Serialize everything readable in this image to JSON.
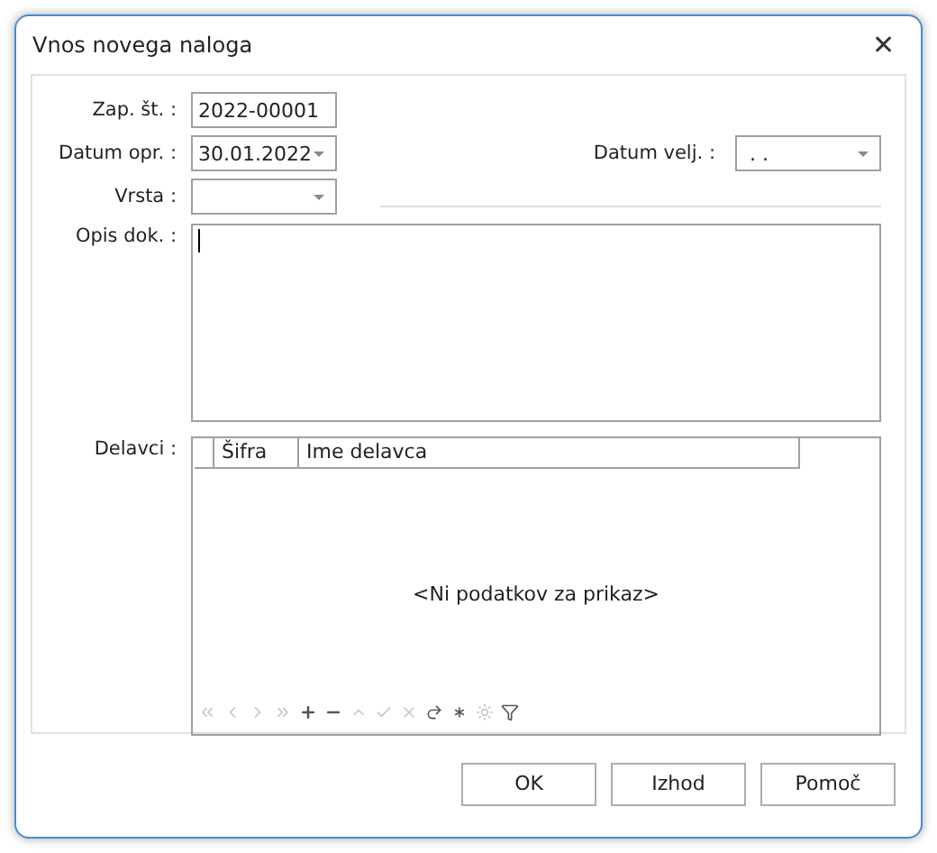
{
  "window": {
    "title": "Vnos novega naloga",
    "close": "✕"
  },
  "form": {
    "number": {
      "label": "Zap. št. :",
      "value": "2022-00001"
    },
    "date": {
      "label": "Datum opr. :",
      "value": "30.01.2022"
    },
    "valid_date": {
      "label": "Datum velj. :",
      "value": ". ."
    },
    "type": {
      "label": "Vrsta :"
    },
    "description": {
      "label": "Opis dok. :"
    }
  },
  "workers": {
    "label": "Delavci :",
    "columns": [
      "Šifra",
      "Ime delavca"
    ],
    "empty_text": "<Ni podatkov za prikaz>",
    "navigator": [
      {
        "kind": "first",
        "disabled": true
      },
      {
        "kind": "prev",
        "disabled": true
      },
      {
        "kind": "next",
        "disabled": true
      },
      {
        "kind": "last",
        "disabled": true
      },
      {
        "kind": "add",
        "disabled": false
      },
      {
        "kind": "remove",
        "disabled": false
      },
      {
        "kind": "up",
        "disabled": true
      },
      {
        "kind": "check",
        "disabled": true
      },
      {
        "kind": "cancel",
        "disabled": true
      },
      {
        "kind": "redo",
        "disabled": false
      },
      {
        "kind": "star",
        "disabled": false
      },
      {
        "kind": "star2",
        "disabled": true
      },
      {
        "kind": "filter",
        "disabled": false
      }
    ]
  },
  "buttons": [
    "OK",
    "Izhod",
    "Pomoč"
  ]
}
